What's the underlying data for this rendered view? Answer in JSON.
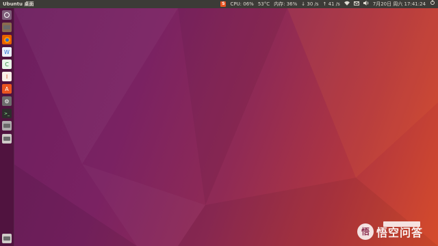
{
  "top_panel": {
    "title": "Ubuntu 桌面",
    "input_method": "S",
    "cpu": "CPU: 06%",
    "temp": "53°C",
    "memory": "内存: 36%",
    "download": "↓ 30 /s",
    "upload": "↑ 41 /s",
    "wifi_icon": "wifi-icon",
    "mail_icon": "mail-icon",
    "volume_icon": "volume-icon",
    "datetime": "7月20日 周六 17:41:24",
    "power_icon": "power-icon"
  },
  "launcher": {
    "items": [
      {
        "name": "dash",
        "icon": "dash-icon"
      },
      {
        "name": "files",
        "icon": "files-icon"
      },
      {
        "name": "firefox",
        "icon": "firefox-icon"
      },
      {
        "name": "libreoffice-writer",
        "icon": "writer-icon",
        "glyph": "W"
      },
      {
        "name": "libreoffice-calc",
        "icon": "calc-icon",
        "glyph": "C"
      },
      {
        "name": "libreoffice-impress",
        "icon": "impress-icon",
        "glyph": "I"
      },
      {
        "name": "ubuntu-software",
        "icon": "software-icon",
        "glyph": "A"
      },
      {
        "name": "system-settings",
        "icon": "settings-icon",
        "glyph": "⚙"
      },
      {
        "name": "terminal",
        "icon": "terminal-icon",
        "glyph": ">_"
      },
      {
        "name": "drive",
        "icon": "drive-icon"
      },
      {
        "name": "trash",
        "icon": "trash-icon"
      }
    ]
  },
  "watermark": {
    "logo": "悟",
    "text": "悟空问答"
  }
}
